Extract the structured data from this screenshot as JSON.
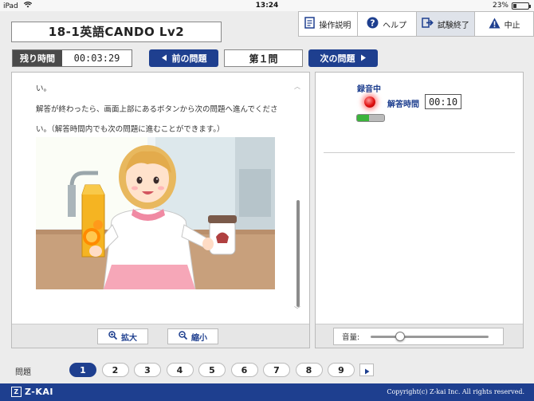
{
  "status_bar": {
    "device": "iPad",
    "time": "13:24",
    "battery": "23%",
    "battery_level": 0.23
  },
  "header": {
    "title": "18-1英語CANDO Lv2"
  },
  "toolbar": {
    "manual": "操作説明",
    "help": "ヘルプ",
    "end_exam": "試験終了",
    "abort": "中止"
  },
  "timer": {
    "label": "残り時間",
    "value": "00:03:29"
  },
  "navigation": {
    "prev": "前の問題",
    "current": "第１問",
    "next": "次の問題"
  },
  "question": {
    "lines": [
      "い。",
      "解答が終わったら、画面上部にあるボタンから次の問題へ進んでくださ",
      "い。（解答時間内でも次の問題に進むことができます。）"
    ]
  },
  "zoom": {
    "in": "拡大",
    "out": "縮小"
  },
  "recording": {
    "label": "録音中",
    "answer_time_label": "解答時間",
    "answer_time": "00:10",
    "level": 0.45
  },
  "volume": {
    "label": "音量:",
    "level": 0.25
  },
  "pager": {
    "label": "問題",
    "pages": [
      "1",
      "2",
      "3",
      "4",
      "5",
      "6",
      "7",
      "8",
      "9"
    ],
    "active_index": 0
  },
  "footer": {
    "brand": "Z-KAI",
    "copyright": "Copyright(c) Z-kai Inc. All rights reserved."
  },
  "colors": {
    "primary": "#1e3f8f",
    "recording": "#e01010",
    "level": "#3bb43b"
  }
}
